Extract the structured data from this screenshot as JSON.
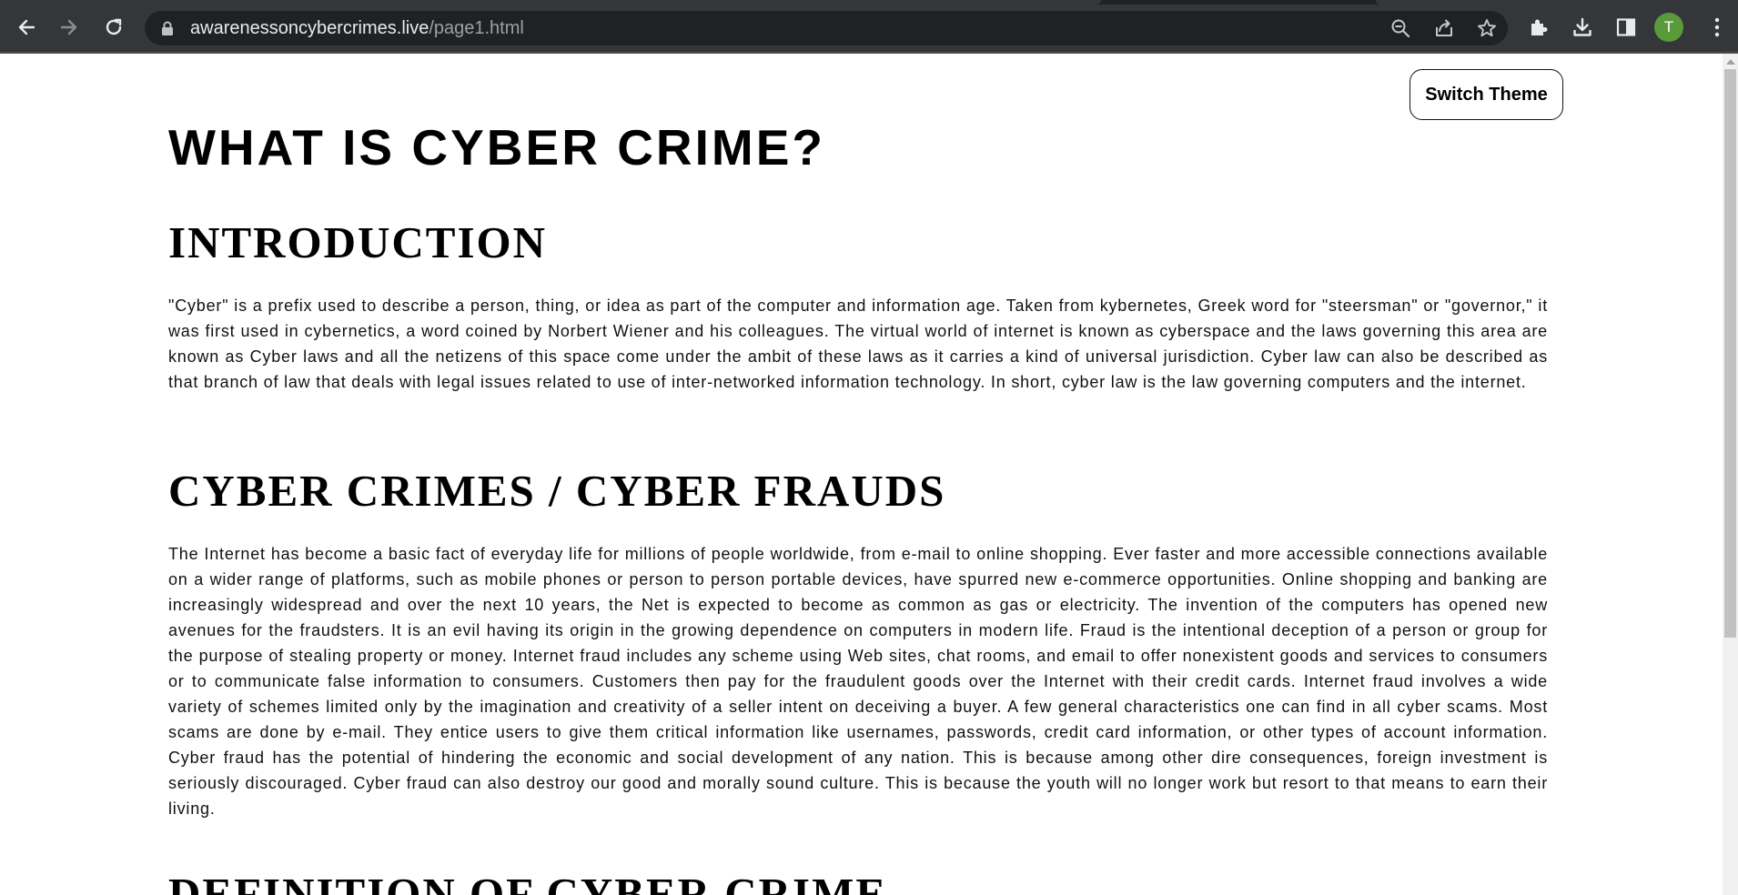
{
  "browser": {
    "url_host": "awarenessoncybercrimes.live",
    "url_path": "/page1.html",
    "avatar_letter": "T",
    "avatar_color": "#5a9a3a",
    "icons": [
      "back-arrow-icon",
      "forward-arrow-icon",
      "reload-icon",
      "lock-icon",
      "zoom-icon",
      "share-icon",
      "bookmark-star-icon",
      "extensions-puzzle-icon",
      "download-icon",
      "side-panel-icon",
      "more-menu-icon"
    ]
  },
  "page": {
    "switch_theme_label": "Switch Theme",
    "title": "WHAT IS CYBER CRIME?",
    "sections": [
      {
        "heading": "INTRODUCTION",
        "paragraph": "\"Cyber\" is a prefix used to describe a person, thing, or idea as part of the computer and information age. Taken from kybernetes, Greek word for \"steersman\" or \"governor,\" it was first used in cybernetics, a word coined by Norbert Wiener and his colleagues. The virtual world of internet is known as cyberspace and the laws governing this area are known as Cyber laws and all the netizens of this space come under the ambit of these laws as it carries a kind of universal jurisdiction. Cyber law can also be described as that branch of law that deals with legal issues related to use of inter-networked information technology. In short, cyber law is the law governing computers and the internet."
      },
      {
        "heading": "CYBER CRIMES / CYBER FRAUDS",
        "paragraph": "The Internet has become a basic fact of everyday life for millions of people worldwide, from e-mail to online shopping. Ever faster and more accessible connections available on a wider range of platforms, such as mobile phones or person to person portable devices, have spurred new e-commerce opportunities. Online shopping and banking are increasingly widespread and over the next 10 years, the Net is expected to become as common as gas or electricity. The invention of the computers has opened new avenues for the fraudsters. It is an evil having its origin in the growing dependence on computers in modern life. Fraud is the intentional deception of a person or group for the purpose of stealing property or money. Internet fraud includes any scheme using Web sites, chat rooms, and email to offer nonexistent goods and services to consumers or to communicate false information to consumers. Customers then pay for the fraudulent goods over the Internet with their credit cards. Internet fraud involves a wide variety of schemes limited only by the imagination and creativity of a seller intent on deceiving a buyer. A few general characteristics one can find in all cyber scams. Most scams are done by e-mail. They entice users to give them critical information like usernames, passwords, credit card information, or other types of account information. Cyber fraud has the potential of hindering the economic and social development of any nation. This is because among other dire consequences, foreign investment is seriously discouraged. Cyber fraud can also destroy our good and morally sound culture. This is because the youth will no longer work but resort to that means to earn their living."
      },
      {
        "heading": "DEFINITION OF CYBER CRIME"
      }
    ]
  }
}
